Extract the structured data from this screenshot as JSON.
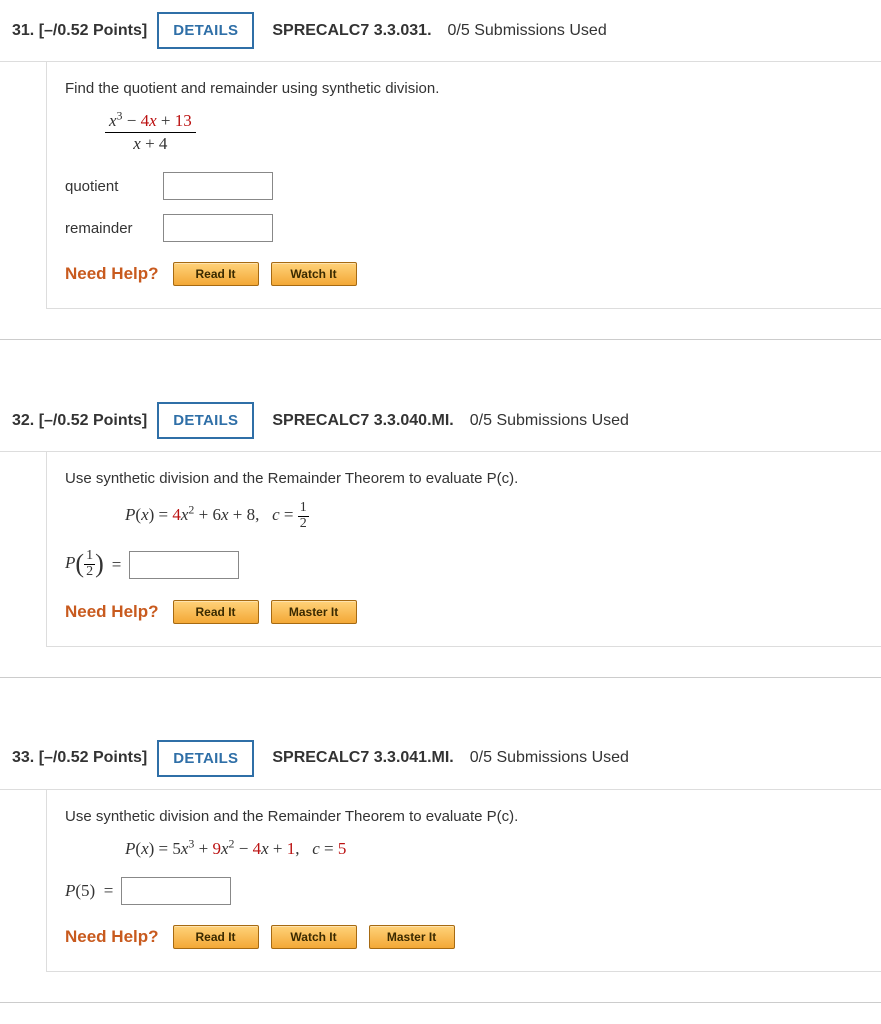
{
  "questions": [
    {
      "number": "31.",
      "points": "[–/0.52 Points]",
      "details": "DETAILS",
      "source": "SPRECALC7 3.3.031.",
      "submissions": "0/5 Submissions Used",
      "prompt": "Find the quotient and remainder using synthetic division.",
      "labels": {
        "quotient": "quotient",
        "remainder": "remainder"
      },
      "help": {
        "label": "Need Help?",
        "buttons": [
          "Read It",
          "Watch It"
        ]
      }
    },
    {
      "number": "32.",
      "points": "[–/0.52 Points]",
      "details": "DETAILS",
      "source": "SPRECALC7 3.3.040.MI.",
      "submissions": "0/5 Submissions Used",
      "prompt": "Use synthetic division and the Remainder Theorem to evaluate P(c).",
      "help": {
        "label": "Need Help?",
        "buttons": [
          "Read It",
          "Master It"
        ]
      }
    },
    {
      "number": "33.",
      "points": "[–/0.52 Points]",
      "details": "DETAILS",
      "source": "SPRECALC7 3.3.041.MI.",
      "submissions": "0/5 Submissions Used",
      "prompt": "Use synthetic division and the Remainder Theorem to evaluate P(c).",
      "help": {
        "label": "Need Help?",
        "buttons": [
          "Read It",
          "Watch It",
          "Master It"
        ]
      }
    }
  ]
}
